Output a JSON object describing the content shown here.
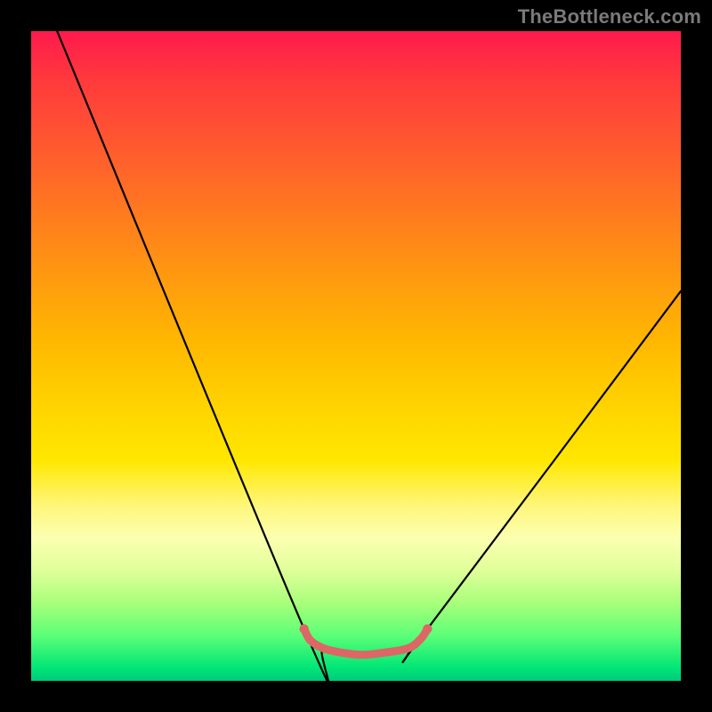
{
  "watermark": "TheBottleneck.com",
  "chart_data": {
    "type": "line",
    "title": "",
    "xlabel": "",
    "ylabel": "",
    "xlim": [
      0,
      100
    ],
    "ylim": [
      0,
      100
    ],
    "series": [
      {
        "name": "bottleneck-curve",
        "points": [
          {
            "x": 4,
            "y": 100
          },
          {
            "x": 42,
            "y": 8
          },
          {
            "x": 45,
            "y": 5
          },
          {
            "x": 51,
            "y": 4
          },
          {
            "x": 58,
            "y": 5
          },
          {
            "x": 61,
            "y": 8
          },
          {
            "x": 100,
            "y": 60
          }
        ],
        "color": "#000000"
      },
      {
        "name": "optimal-zone",
        "points": [
          {
            "x": 42,
            "y": 8
          },
          {
            "x": 43,
            "y": 6.2
          },
          {
            "x": 45,
            "y": 5
          },
          {
            "x": 48,
            "y": 4.3
          },
          {
            "x": 51,
            "y": 4
          },
          {
            "x": 54,
            "y": 4.3
          },
          {
            "x": 58,
            "y": 5
          },
          {
            "x": 60,
            "y": 6.5
          },
          {
            "x": 61,
            "y": 8
          }
        ],
        "color": "#dd6666"
      }
    ],
    "background_gradient": {
      "top": "#ff1a4d",
      "bottom": "#00c97a"
    }
  }
}
